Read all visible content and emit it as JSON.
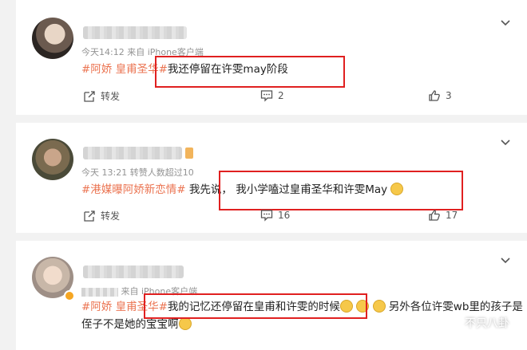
{
  "posts": [
    {
      "meta": "今天14:12  来自 iPhone客户端",
      "tag": "#阿娇 皇甫圣华#",
      "text": "我还停留在许雯may阶段",
      "share_label": "转发",
      "comment_count": "2",
      "like_count": "3"
    },
    {
      "meta": "今天 13:21 转赞人数超过10",
      "tag": "#港媒曝阿娇新恋情#",
      "text": " 我先说，  我小学嗑过皇甫圣华和许雯May",
      "share_label": "转发",
      "comment_count": "16",
      "like_count": "17"
    },
    {
      "meta_suffix": "来自 iPhone客户端",
      "tag": "#阿娇 皇甫圣华#",
      "text": "我的记忆还停留在皇甫和许雯的时候",
      "text_rest": "另外各位许雯wb里的孩子是侄子不是她的宝宝啊"
    }
  ],
  "watermark": "不只八卦",
  "colors": {
    "tag": "#eb7350",
    "highlight": "#e02020"
  }
}
